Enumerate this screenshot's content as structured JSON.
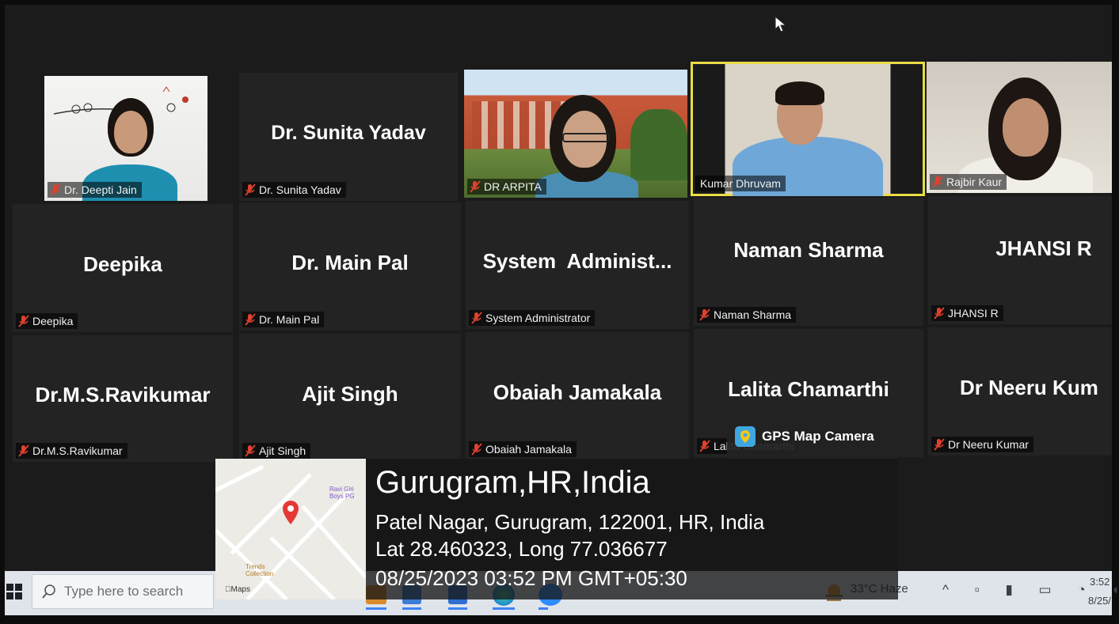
{
  "meeting": {
    "row1": [
      {
        "tag": "Dr. Deepti Jain",
        "video": true
      },
      {
        "title": "Dr. Sunita Yadav",
        "tag": "Dr. Sunita Yadav"
      },
      {
        "tag": "DR ARPITA",
        "video": true
      },
      {
        "tag": "Kumar Dhruvam",
        "video": true,
        "active": true
      },
      {
        "tag": "Rajbir Kaur",
        "video": true
      }
    ],
    "row2": [
      {
        "title": "Deepika",
        "tag": "Deepika"
      },
      {
        "title": "Dr. Main Pal",
        "tag": "Dr. Main Pal"
      },
      {
        "title": "System  Administ...",
        "tag": "System Administrator"
      },
      {
        "title": "Naman Sharma",
        "tag": "Naman Sharma"
      },
      {
        "title": "JHANSI R",
        "tag": "JHANSI R"
      }
    ],
    "row3": [
      {
        "title": "Dr.M.S.Ravikumar",
        "tag": "Dr.M.S.Ravikumar"
      },
      {
        "title": "Ajit Singh",
        "tag": "Ajit Singh"
      },
      {
        "title": "Obaiah Jamakala",
        "tag": "Obaiah Jamakala"
      },
      {
        "title": "Lalita Chamarthi",
        "tag": "Lalita Chamarthi"
      },
      {
        "title": "Dr Neeru Kum",
        "tag": "Dr Neeru Kumar"
      }
    ]
  },
  "gps": {
    "badge": "GPS Map Camera",
    "city": "Gurugram,HR,India",
    "address": "Patel Nagar, Gurugram, 122001, HR, India",
    "coords": "Lat 28.460323, Long 77.036677",
    "datetime": "08/25/2023 03:52 PM GMT+05:30",
    "map_labels": {
      "poi1": "Ravi Giri Boys PG",
      "poi2": "Trends Collection",
      "maps_brand": "Maps"
    },
    "colors": {
      "pin": "#e53935",
      "poi": "#7e57c2",
      "poi_orange": "#f0a020"
    }
  },
  "taskbar": {
    "search_placeholder": "Type here to search",
    "weather": "33°C  Haze",
    "clock_time": "3:52",
    "clock_date": "8/25/"
  }
}
